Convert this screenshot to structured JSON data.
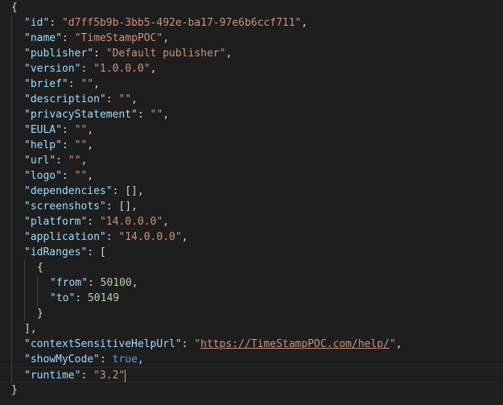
{
  "editor": {
    "colors": {
      "background": "#1e1e1e",
      "key": "#9cdcfe",
      "string": "#ce9178",
      "number": "#b5cea8",
      "keyword": "#569cd6",
      "punctuation": "#d4d4d4"
    },
    "lines": [
      {
        "indent": 0,
        "tokens": [
          {
            "t": "p",
            "v": "{"
          }
        ]
      },
      {
        "indent": 1,
        "tokens": [
          {
            "t": "key",
            "v": "\"id\""
          },
          {
            "t": "p",
            "v": ": "
          },
          {
            "t": "str",
            "v": "\"d7ff5b9b-3bb5-492e-ba17-97e6b6ccf711\""
          },
          {
            "t": "p",
            "v": ","
          }
        ]
      },
      {
        "indent": 1,
        "tokens": [
          {
            "t": "key",
            "v": "\"name\""
          },
          {
            "t": "p",
            "v": ": "
          },
          {
            "t": "str",
            "v": "\"TimeStampPOC\""
          },
          {
            "t": "p",
            "v": ","
          }
        ]
      },
      {
        "indent": 1,
        "tokens": [
          {
            "t": "key",
            "v": "\"publisher\""
          },
          {
            "t": "p",
            "v": ": "
          },
          {
            "t": "str",
            "v": "\"Default publisher\""
          },
          {
            "t": "p",
            "v": ","
          }
        ]
      },
      {
        "indent": 1,
        "tokens": [
          {
            "t": "key",
            "v": "\"version\""
          },
          {
            "t": "p",
            "v": ": "
          },
          {
            "t": "str",
            "v": "\"1.0.0.0\""
          },
          {
            "t": "p",
            "v": ","
          }
        ]
      },
      {
        "indent": 1,
        "tokens": [
          {
            "t": "key",
            "v": "\"brief\""
          },
          {
            "t": "p",
            "v": ": "
          },
          {
            "t": "str",
            "v": "\"\""
          },
          {
            "t": "p",
            "v": ","
          }
        ]
      },
      {
        "indent": 1,
        "tokens": [
          {
            "t": "key",
            "v": "\"description\""
          },
          {
            "t": "p",
            "v": ": "
          },
          {
            "t": "str",
            "v": "\"\""
          },
          {
            "t": "p",
            "v": ","
          }
        ]
      },
      {
        "indent": 1,
        "tokens": [
          {
            "t": "key",
            "v": "\"privacyStatement\""
          },
          {
            "t": "p",
            "v": ": "
          },
          {
            "t": "str",
            "v": "\"\""
          },
          {
            "t": "p",
            "v": ","
          }
        ]
      },
      {
        "indent": 1,
        "tokens": [
          {
            "t": "key",
            "v": "\"EULA\""
          },
          {
            "t": "p",
            "v": ": "
          },
          {
            "t": "str",
            "v": "\"\""
          },
          {
            "t": "p",
            "v": ","
          }
        ]
      },
      {
        "indent": 1,
        "tokens": [
          {
            "t": "key",
            "v": "\"help\""
          },
          {
            "t": "p",
            "v": ": "
          },
          {
            "t": "str",
            "v": "\"\""
          },
          {
            "t": "p",
            "v": ","
          }
        ]
      },
      {
        "indent": 1,
        "tokens": [
          {
            "t": "key",
            "v": "\"url\""
          },
          {
            "t": "p",
            "v": ": "
          },
          {
            "t": "str",
            "v": "\"\""
          },
          {
            "t": "p",
            "v": ","
          }
        ]
      },
      {
        "indent": 1,
        "tokens": [
          {
            "t": "key",
            "v": "\"logo\""
          },
          {
            "t": "p",
            "v": ": "
          },
          {
            "t": "str",
            "v": "\"\""
          },
          {
            "t": "p",
            "v": ","
          }
        ]
      },
      {
        "indent": 1,
        "tokens": [
          {
            "t": "key",
            "v": "\"dependencies\""
          },
          {
            "t": "p",
            "v": ": [],"
          }
        ]
      },
      {
        "indent": 1,
        "tokens": [
          {
            "t": "key",
            "v": "\"screenshots\""
          },
          {
            "t": "p",
            "v": ": [],"
          }
        ]
      },
      {
        "indent": 1,
        "tokens": [
          {
            "t": "key",
            "v": "\"platform\""
          },
          {
            "t": "p",
            "v": ": "
          },
          {
            "t": "str",
            "v": "\"14.0.0.0\""
          },
          {
            "t": "p",
            "v": ","
          }
        ]
      },
      {
        "indent": 1,
        "tokens": [
          {
            "t": "key",
            "v": "\"application\""
          },
          {
            "t": "p",
            "v": ": "
          },
          {
            "t": "str",
            "v": "\"14.0.0.0\""
          },
          {
            "t": "p",
            "v": ","
          }
        ]
      },
      {
        "indent": 1,
        "tokens": [
          {
            "t": "key",
            "v": "\"idRanges\""
          },
          {
            "t": "p",
            "v": ": ["
          }
        ]
      },
      {
        "indent": 2,
        "tokens": [
          {
            "t": "p",
            "v": "{"
          }
        ]
      },
      {
        "indent": 3,
        "tokens": [
          {
            "t": "key",
            "v": "\"from\""
          },
          {
            "t": "p",
            "v": ": "
          },
          {
            "t": "num",
            "v": "50100"
          },
          {
            "t": "p",
            "v": ","
          }
        ]
      },
      {
        "indent": 3,
        "tokens": [
          {
            "t": "key",
            "v": "\"to\""
          },
          {
            "t": "p",
            "v": ": "
          },
          {
            "t": "num",
            "v": "50149"
          }
        ]
      },
      {
        "indent": 2,
        "tokens": [
          {
            "t": "p",
            "v": "}"
          }
        ]
      },
      {
        "indent": 1,
        "tokens": [
          {
            "t": "p",
            "v": "],"
          }
        ]
      },
      {
        "indent": 1,
        "tokens": [
          {
            "t": "key",
            "v": "\"contextSensitiveHelpUrl\""
          },
          {
            "t": "p",
            "v": ": "
          },
          {
            "t": "str",
            "v": "\""
          },
          {
            "t": "link",
            "v": "https://TimeStampPOC.com/help/"
          },
          {
            "t": "str",
            "v": "\""
          },
          {
            "t": "p",
            "v": ","
          }
        ]
      },
      {
        "indent": 1,
        "tokens": [
          {
            "t": "key",
            "v": "\"showMyCode\""
          },
          {
            "t": "p",
            "v": ": "
          },
          {
            "t": "kw",
            "v": "true"
          },
          {
            "t": "p",
            "v": ","
          }
        ]
      },
      {
        "indent": 1,
        "current": true,
        "cursor": true,
        "tokens": [
          {
            "t": "key",
            "v": "\"runtime\""
          },
          {
            "t": "p",
            "v": ": "
          },
          {
            "t": "str",
            "v": "\"3.2\""
          }
        ]
      },
      {
        "indent": 0,
        "tokens": [
          {
            "t": "p",
            "v": "}"
          }
        ]
      }
    ]
  }
}
